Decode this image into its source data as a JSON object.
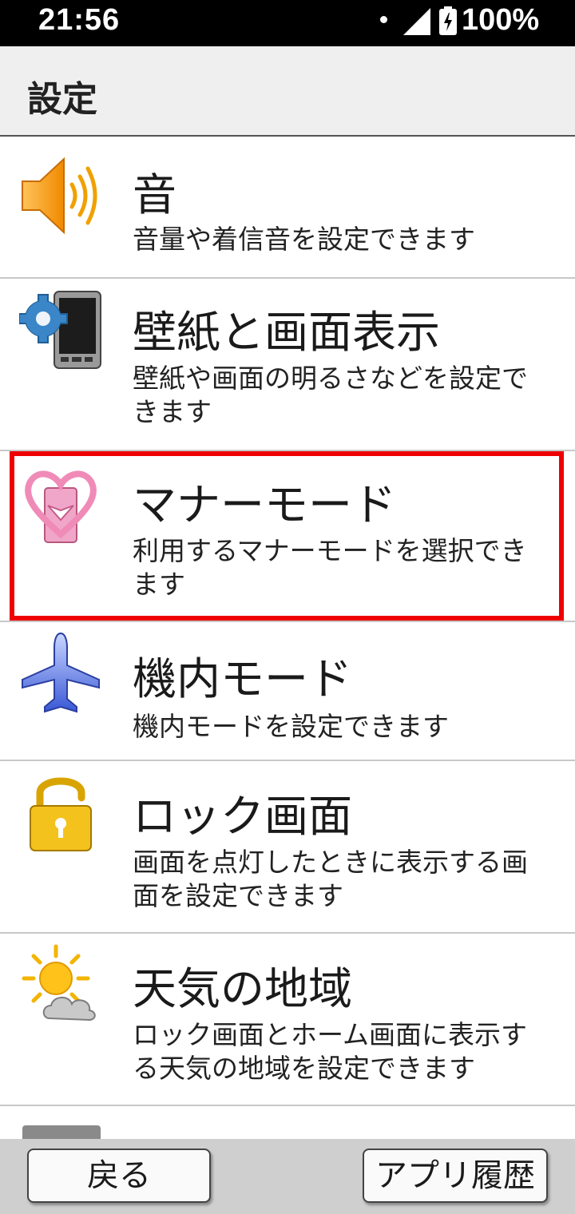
{
  "status_bar": {
    "time": "21:56",
    "battery": "100%"
  },
  "header": {
    "title": "設定"
  },
  "items": [
    {
      "title": "音",
      "desc": "音量や着信音を設定できます",
      "icon": "speaker-icon"
    },
    {
      "title": "壁紙と画面表示",
      "desc": "壁紙や画面の明るさなどを設定できます",
      "icon": "wallpaper-display-icon"
    },
    {
      "title": "マナーモード",
      "desc": "利用するマナーモードを選択できます",
      "icon": "manner-mode-icon"
    },
    {
      "title": "機内モード",
      "desc": "機内モードを設定できます",
      "icon": "airplane-icon"
    },
    {
      "title": "ロック画面",
      "desc": "画面を点灯したときに表示する画面を設定できます",
      "icon": "lock-icon"
    },
    {
      "title": "天気の地域",
      "desc": "ロック画面とホーム画面に表示する天気の地域を設定できます",
      "icon": "weather-icon"
    }
  ],
  "bottom_bar": {
    "back_label": "戻る",
    "history_label": "アプリ履歴"
  },
  "colors": {
    "highlight": "#ee0000",
    "header_bg": "#efefef",
    "bottom_bg": "#cfcfcf"
  }
}
